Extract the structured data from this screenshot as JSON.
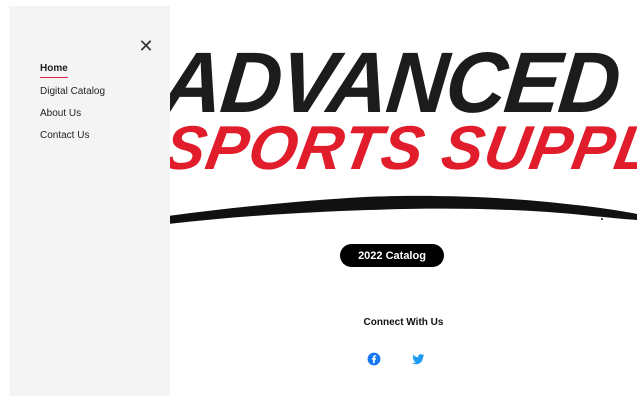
{
  "drawer": {
    "close_icon": "close-icon",
    "nav_items": [
      {
        "label": "Home",
        "active": true
      },
      {
        "label": "Digital Catalog",
        "active": false
      },
      {
        "label": "About Us",
        "active": false
      },
      {
        "label": "Contact Us",
        "active": false
      }
    ]
  },
  "logo": {
    "word1": "ADVANCED",
    "word2": "SPORTS SUPPLY",
    "color_primary": "#1c1c1c",
    "color_accent": "#e11d2c"
  },
  "catalog_button": {
    "label": "2022 Catalog"
  },
  "connect": {
    "title": "Connect With Us",
    "socials": [
      "facebook-icon",
      "twitter-icon"
    ]
  }
}
